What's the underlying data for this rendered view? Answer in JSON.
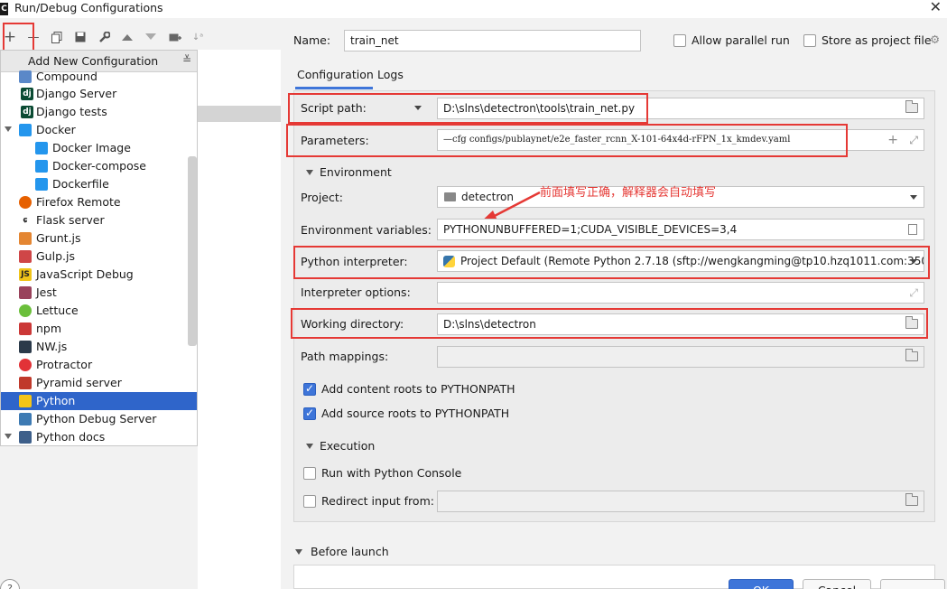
{
  "window": {
    "title": "Run/Debug Configurations"
  },
  "toolbar": {
    "add_label": "+",
    "remove_label": "—"
  },
  "popup": {
    "header": "Add New Configuration",
    "items": [
      {
        "label": "Compound",
        "icon": "compound-icon"
      },
      {
        "label": "Django Server",
        "icon": "django-icon"
      },
      {
        "label": "Django tests",
        "icon": "django-tests-icon"
      },
      {
        "label": "Docker",
        "icon": "docker-icon"
      },
      {
        "label": "Docker Image",
        "icon": "docker-icon"
      },
      {
        "label": "Docker-compose",
        "icon": "docker-icon"
      },
      {
        "label": "Dockerfile",
        "icon": "docker-icon"
      },
      {
        "label": "Firefox Remote",
        "icon": "firefox-icon"
      },
      {
        "label": "Flask server",
        "icon": "flask-icon"
      },
      {
        "label": "Grunt.js",
        "icon": "grunt-icon"
      },
      {
        "label": "Gulp.js",
        "icon": "gulp-icon"
      },
      {
        "label": "JavaScript Debug",
        "icon": "js-debug-icon"
      },
      {
        "label": "Jest",
        "icon": "jest-icon"
      },
      {
        "label": "Lettuce",
        "icon": "lettuce-icon"
      },
      {
        "label": "npm",
        "icon": "npm-icon"
      },
      {
        "label": "NW.js",
        "icon": "nwjs-icon"
      },
      {
        "label": "Protractor",
        "icon": "protractor-icon"
      },
      {
        "label": "Pyramid server",
        "icon": "pyramid-icon"
      },
      {
        "label": "Python",
        "icon": "python-icon"
      },
      {
        "label": "Python Debug Server",
        "icon": "python-debug-icon"
      },
      {
        "label": "Python docs",
        "icon": "python-docs-icon"
      }
    ]
  },
  "form": {
    "name_label": "Name:",
    "name_value": "train_net",
    "allow_parallel": "Allow parallel run",
    "store_project": "Store as project file",
    "tab_configuration": "Configuration",
    "tab_logs": "Logs",
    "script_path_label": "Script path:",
    "script_path_value": "D:\\slns\\detectron\\tools\\train_net.py",
    "parameters_label": "Parameters:",
    "parameters_value": "—cfg configs/publaynet/e2e_faster_rcnn_X-101-64x4d-rFPN_1x_kmdev.yaml",
    "environment_section": "Environment",
    "project_label": "Project:",
    "project_value": "detectron",
    "env_vars_label": "Environment variables:",
    "env_vars_value": "PYTHONUNBUFFERED=1;CUDA_VISIBLE_DEVICES=3,4",
    "interpreter_label": "Python interpreter:",
    "interpreter_value": "Project Default (Remote Python 2.7.18 (sftp://wengkangming@tp10.hzq1011.com:350",
    "interp_options_label": "Interpreter options:",
    "working_dir_label": "Working directory:",
    "working_dir_value": "D:\\slns\\detectron",
    "path_mappings_label": "Path mappings:",
    "add_content_roots": "Add content roots to PYTHONPATH",
    "add_source_roots": "Add source roots to PYTHONPATH",
    "execution_section": "Execution",
    "run_console": "Run with Python Console",
    "redirect_input": "Redirect input from:",
    "before_launch": "Before launch"
  },
  "annotation": "前面填写正确，解释器会自动填写",
  "buttons": {
    "ok": "OK",
    "cancel": "Cancel"
  }
}
